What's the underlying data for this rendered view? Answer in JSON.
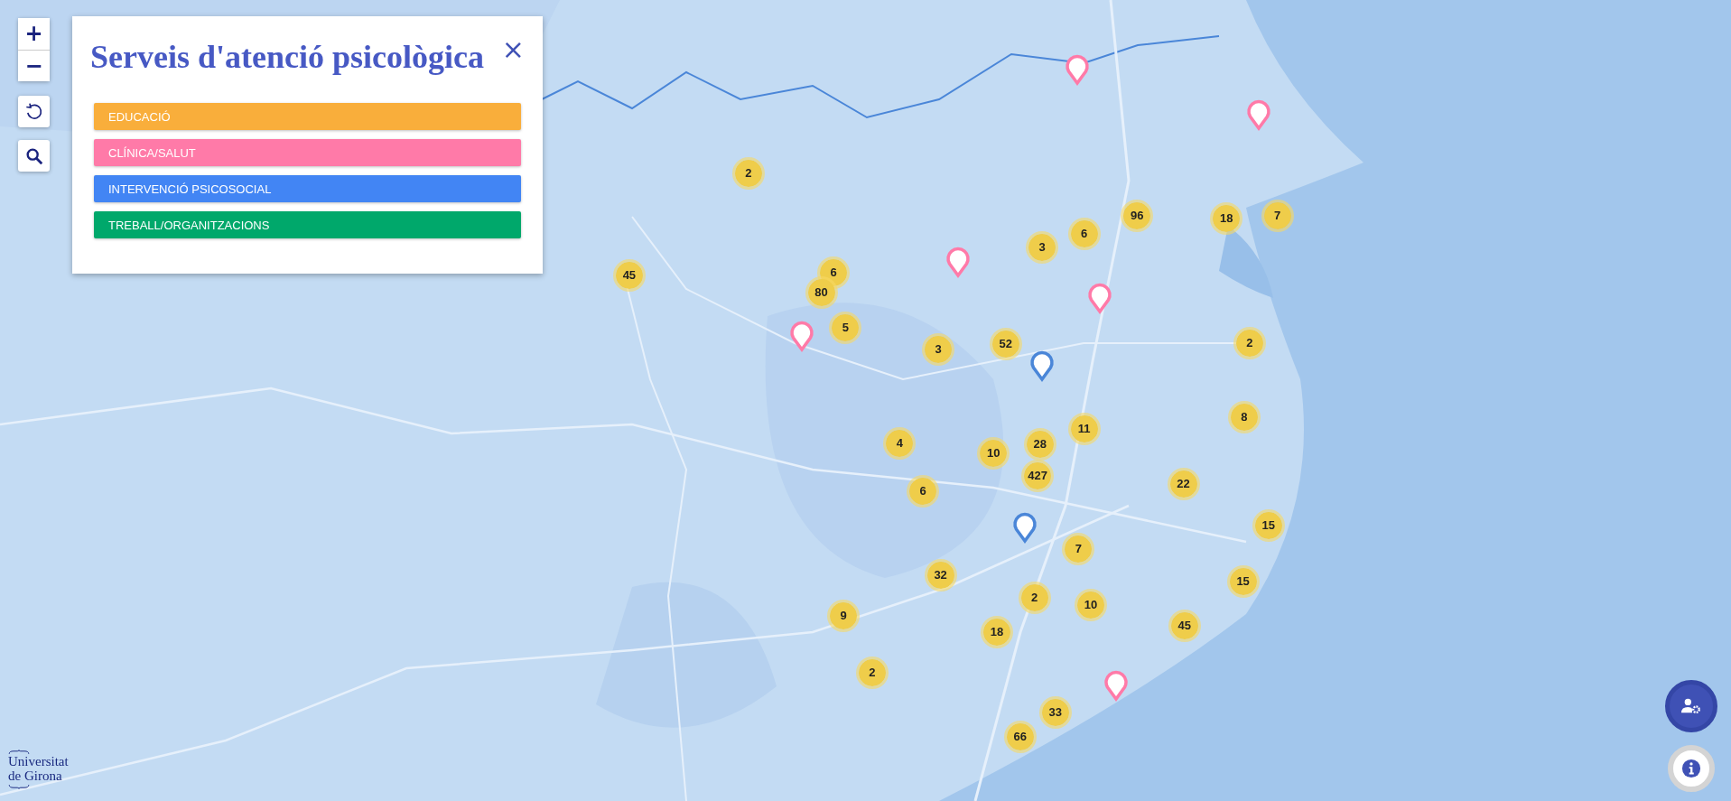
{
  "map_controls": {
    "zoom_in": "+",
    "zoom_out": "−"
  },
  "panel": {
    "title": "Serveis d'atenció psicològica",
    "close": "×",
    "categories": [
      {
        "label": "EDUCACIÓ",
        "color": "#f9ae3b"
      },
      {
        "label": "CLÍNICA/SALUT",
        "color": "#ff7aa8"
      },
      {
        "label": "INTERVENCIÓ PSICOSOCIAL",
        "color": "#4285f4"
      },
      {
        "label": "TREBALL/ORGANITZACIONS",
        "color": "#00a86b"
      }
    ]
  },
  "clusters": [
    {
      "count": "2"
    },
    {
      "count": "45"
    },
    {
      "count": "6"
    },
    {
      "count": "80"
    },
    {
      "count": "5"
    },
    {
      "count": "3"
    },
    {
      "count": "52"
    },
    {
      "count": "3"
    },
    {
      "count": "6"
    },
    {
      "count": "96"
    },
    {
      "count": "18"
    },
    {
      "count": "7"
    },
    {
      "count": "2"
    },
    {
      "count": "8"
    },
    {
      "count": "11"
    },
    {
      "count": "4"
    },
    {
      "count": "10"
    },
    {
      "count": "28"
    },
    {
      "count": "427"
    },
    {
      "count": "6"
    },
    {
      "count": "22"
    },
    {
      "count": "15"
    },
    {
      "count": "15"
    },
    {
      "count": "7"
    },
    {
      "count": "32"
    },
    {
      "count": "2"
    },
    {
      "count": "10"
    },
    {
      "count": "9"
    },
    {
      "count": "18"
    },
    {
      "count": "45"
    },
    {
      "count": "2"
    },
    {
      "count": "33"
    },
    {
      "count": "66"
    }
  ],
  "pins": [
    {
      "color": "#ff7aa8"
    },
    {
      "color": "#ff7aa8"
    },
    {
      "color": "#ff7aa8"
    },
    {
      "color": "#ff7aa8"
    },
    {
      "color": "#ff7aa8"
    },
    {
      "color": "#ff7aa8"
    },
    {
      "color": "#4a86d8"
    },
    {
      "color": "#4a86d8"
    }
  ],
  "logo": {
    "line_1": "Universitat",
    "line_2": "de Girona"
  }
}
